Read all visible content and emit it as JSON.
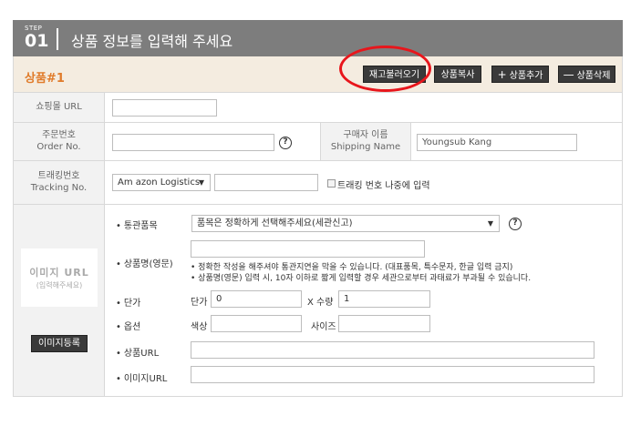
{
  "header": {
    "step_label": "STEP",
    "step_number": "01",
    "title": "상품 정보를 입력해 주세요"
  },
  "product_bar": {
    "title": "상품#1",
    "buttons": {
      "load_stock": "재고불러오기",
      "copy": "상품복사",
      "add": "상품추가",
      "delete": "상품삭제"
    },
    "add_icon": "plus-icon",
    "delete_icon": "minus-icon"
  },
  "shopping_url": {
    "label": "쇼핑몰 URL",
    "value": ""
  },
  "order": {
    "label_ko": "주문번호",
    "label_en": "Order No.",
    "value": "",
    "shipping_label_ko": "구매자 이름",
    "shipping_label_en": "Shipping Name",
    "shipping_value": "Youngsub Kang"
  },
  "tracking": {
    "label_ko": "트래킹번호",
    "label_en": "Tracking No.",
    "carrier": "Am azon Logistics",
    "value": "",
    "later_label": "트래킹 번호 나중에 입력"
  },
  "image": {
    "placeholder_title": "이미지 URL",
    "placeholder_sub": "(입력해주세요)",
    "register_button": "이미지등록"
  },
  "fields": {
    "customs_label": "통관품목",
    "customs_value": "품목은 정확하게 선택해주세요(세관신고)",
    "name_label": "상품명(영문)",
    "name_value": "",
    "name_note1": "정확한 작성을 해주셔야 통관지연을 막을 수 있습니다. (대표품목, 특수문자, 한글 입력 금지)",
    "name_note2": "상품명(영문) 입력 시, 10자 이하로 짧게 입력할 경우 세관으로부터 과태료가 부과될 수 있습니다.",
    "price_label": "단가",
    "price_inner_label": "단가",
    "price_value": "0",
    "qty_label": "X 수량",
    "qty_value": "1",
    "option_label": "옵션",
    "color_label": "색상",
    "color_value": "",
    "size_label": "사이즈",
    "size_value": "",
    "product_url_label": "상품URL",
    "product_url_value": "",
    "image_url_label": "이미지URL",
    "image_url_value": ""
  },
  "colors": {
    "accent_orange": "#e07b2a",
    "header_gray": "#7d7d7d",
    "highlight_red": "#e8161c"
  }
}
